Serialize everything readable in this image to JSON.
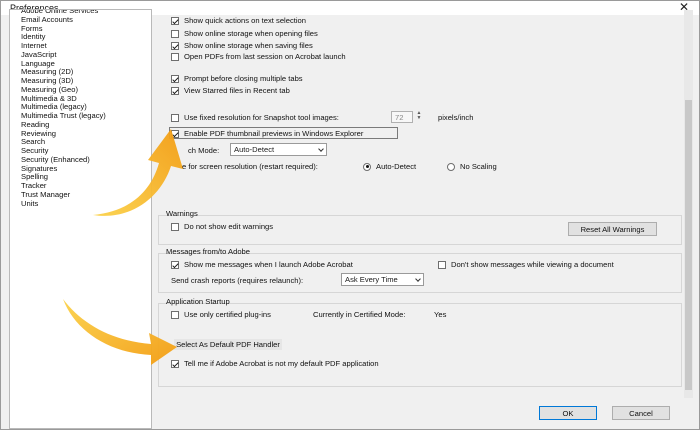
{
  "window": {
    "title": "Preferences",
    "close_glyph": "✕"
  },
  "categories": [
    "Adobe Online Services",
    "Email Accounts",
    "Forms",
    "Identity",
    "Internet",
    "JavaScript",
    "Language",
    "Measuring (2D)",
    "Measuring (3D)",
    "Measuring (Geo)",
    "Multimedia & 3D",
    "Multimedia (legacy)",
    "Multimedia Trust (legacy)",
    "Reading",
    "Reviewing",
    "Search",
    "Security",
    "Security (Enhanced)",
    "Signatures",
    "Spelling",
    "Tracker",
    "Trust Manager",
    "Units"
  ],
  "general": {
    "options": [
      {
        "label": "Show quick actions on text selection",
        "checked": true
      },
      {
        "label": "Show online storage when opening files",
        "checked": false
      },
      {
        "label": "Show online storage when saving files",
        "checked": true
      },
      {
        "label": "Open PDFs from last session on Acrobat launch",
        "checked": false
      },
      {
        "label": "Prompt before closing multiple tabs",
        "checked": true
      },
      {
        "label": "View Starred files in Recent tab",
        "checked": true
      }
    ],
    "snapshot": {
      "label": "Use fixed resolution for Snapshot tool images:",
      "checked": false,
      "value": "72",
      "unit": "pixels/inch"
    },
    "thumbnail": {
      "label": "Enable PDF thumbnail previews in Windows Explorer",
      "checked": true
    },
    "touch_mode": {
      "label": "ch Mode:",
      "value": "Auto-Detect"
    },
    "screen_res": {
      "label": "e for screen resolution (restart required):",
      "auto_label": "Auto-Detect",
      "noscale_label": "No Scaling"
    }
  },
  "warnings": {
    "title": "Warnings",
    "dont_show_label": "Do not show edit warnings",
    "reset_label": "Reset All Warnings"
  },
  "messages": {
    "title": "Messages from/to Adobe",
    "show_label": "Show me messages when I launch Adobe Acrobat",
    "dont_show_label": "Don't show messages while viewing a document",
    "crash_label": "Send crash reports (requires relaunch):",
    "crash_value": "Ask Every Time"
  },
  "startup": {
    "title": "Application Startup",
    "certified_label": "Use only certified plug-ins",
    "mode_label": "Currently in Certified Mode:",
    "mode_value": "Yes",
    "default_button": "Select As Default PDF Handler",
    "tell_me_label": "Tell me if Adobe Acrobat is not my default PDF application"
  },
  "footer": {
    "ok": "OK",
    "cancel": "Cancel"
  },
  "colors": {
    "arrow_orange": "#f39c12",
    "arrow_light": "#fbd24a"
  }
}
